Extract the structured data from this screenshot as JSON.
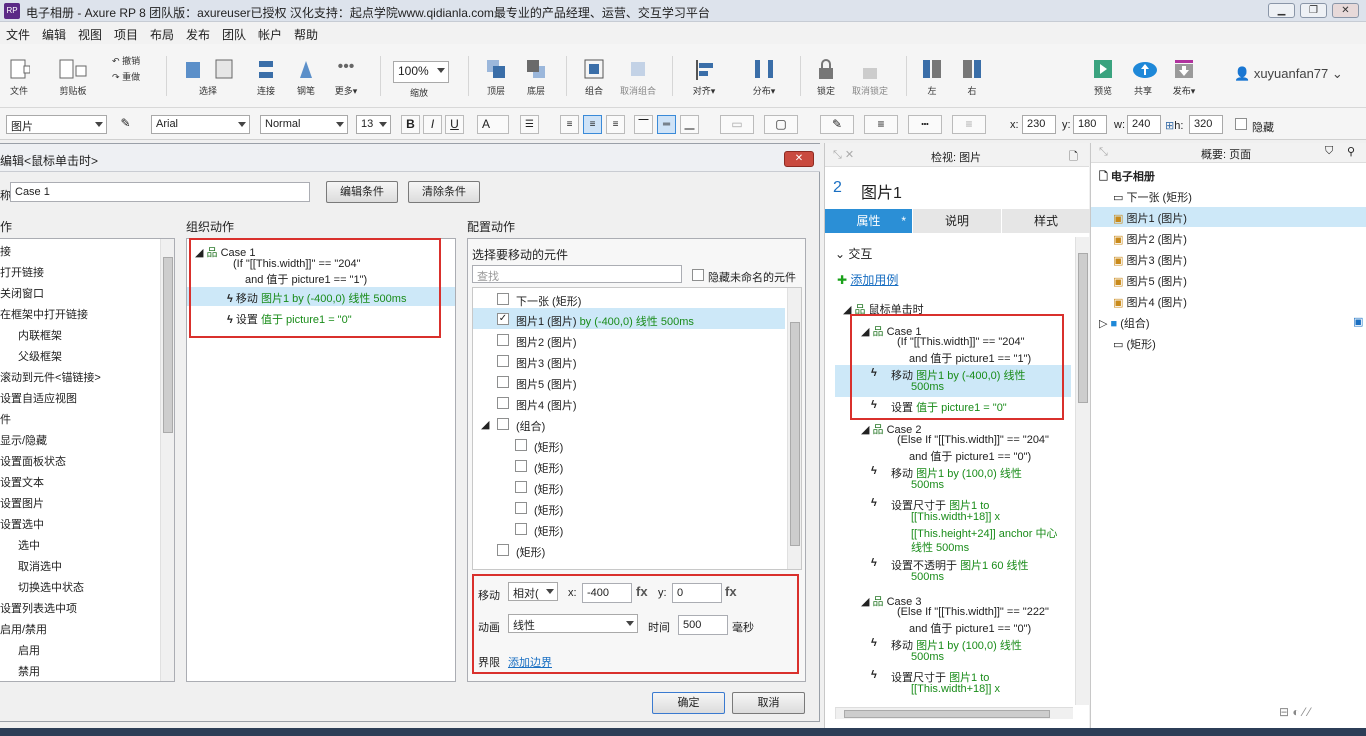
{
  "window": {
    "title": "电子相册 - Axure RP 8 团队版：axureuser已授权 汉化支持：起点学院www.qidianla.com最专业的产品经理、运营、交互学习平台",
    "app_icon": "RP"
  },
  "menu": [
    "文件",
    "编辑",
    "视图",
    "项目",
    "布局",
    "发布",
    "团队",
    "帐户",
    "帮助"
  ],
  "toolbar": {
    "file": "文件",
    "clipboard": "剪贴板",
    "undo": "撤销",
    "redo": "重做",
    "select": "选择",
    "connect": "连接",
    "pen": "钢笔",
    "more": "更多▾",
    "zoom_value": "100%",
    "zoom": "缩放",
    "top": "顶层",
    "bottom": "底层",
    "group": "组合",
    "ungroup": "取消组合",
    "align": "对齐▾",
    "distribute": "分布▾",
    "lock": "锁定",
    "unlock": "取消锁定",
    "left": "左",
    "right": "右",
    "preview": "预览",
    "share": "共享",
    "publish": "发布▾",
    "user": "xuyuanfan77"
  },
  "format": {
    "widget": "图片",
    "font": "Arial",
    "style": "Normal",
    "size": "13",
    "bold": "B",
    "italic": "I",
    "underline": "U",
    "text_color": "A",
    "x_label": "x:",
    "x": "230",
    "y_label": "y:",
    "y": "180",
    "w_label": "w:",
    "w": "240",
    "h_label": "h:",
    "h": "320",
    "hidden": "隐藏"
  },
  "dialog": {
    "title": "编辑<鼠标单击时>",
    "case_label": "称",
    "case_name": "Case 1",
    "edit_condition": "编辑条件",
    "clear_condition": "清除条件",
    "col1_header": "作",
    "col2_header": "组织动作",
    "col3_header": "配置动作",
    "actions": [
      "接",
      "打开链接",
      "关闭窗口",
      "在框架中打开链接",
      "内联框架",
      "父级框架",
      "滚动到元件<锚链接>",
      "设置自适应视图",
      "件",
      "显示/隐藏",
      "设置面板状态",
      "设置文本",
      "设置图片",
      "设置选中",
      "选中",
      "取消选中",
      "切换选中状态",
      "设置列表选中项",
      "启用/禁用",
      "启用",
      "禁用"
    ],
    "org": {
      "case": "Case 1",
      "cond1": "(If \"[[This.width]]\" == \"204\"",
      "cond2": "and 值于 picture1 == \"1\")",
      "a1_verb": "移动",
      "a1_detail": "图片1 by (-400,0) 线性 500ms",
      "a2_verb": "设置",
      "a2_detail": "值于 picture1 = \"0\""
    },
    "config": {
      "header": "选择要移动的元件",
      "search_placeholder": "查找",
      "hide_unnamed": "隐藏未命名的元件",
      "items": [
        {
          "label": "下一张 (矩形)",
          "checked": false
        },
        {
          "label": "图片1 (图片)",
          "checked": true,
          "extra": "by (-400,0) 线性 500ms"
        },
        {
          "label": "图片2 (图片)",
          "checked": false
        },
        {
          "label": "图片3 (图片)",
          "checked": false
        },
        {
          "label": "图片5 (图片)",
          "checked": false
        },
        {
          "label": "图片4 (图片)",
          "checked": false
        }
      ],
      "group": "(组合)",
      "rects": [
        "(矩形)",
        "(矩形)",
        "(矩形)",
        "(矩形)",
        "(矩形)"
      ],
      "last": "(矩形)",
      "move": "移动",
      "move_mode": "相对(",
      "x_label": "x:",
      "x": "-400",
      "fx": "fx",
      "y_label": "y:",
      "y": "0",
      "anim": "动画",
      "anim_value": "线性",
      "time": "时间",
      "time_value": "500",
      "ms": "毫秒",
      "bound": "界限",
      "add_bound": "添加边界"
    },
    "ok": "确定",
    "cancel": "取消"
  },
  "inspector": {
    "title": "检视: 图片",
    "num": "2",
    "name": "图片1",
    "tabs": [
      "属性",
      "说明",
      "样式"
    ],
    "interaction": "交互",
    "add_case": "添加用例",
    "event": "鼠标单击时",
    "cases": [
      {
        "name": "Case 1",
        "cond": [
          "(If \"[[This.width]]\" == \"204\"",
          "and 值于 picture1 == \"1\")"
        ],
        "acts": [
          [
            "移动 ",
            "图片1 by (-400,0) 线性"
          ],
          [
            "",
            "500ms"
          ],
          [
            "设置 ",
            "值于 picture1 = \"0\""
          ]
        ]
      },
      {
        "name": "Case 2",
        "cond": [
          "(Else If \"[[This.width]]\" == \"204\"",
          "and 值于 picture1 == \"0\")"
        ],
        "acts": [
          [
            "移动 ",
            "图片1 by (100,0) 线性"
          ],
          [
            "",
            "500ms"
          ],
          [
            "设置尺寸于 ",
            "图片1 to"
          ],
          [
            "",
            "[[This.width+18]] x"
          ],
          [
            "",
            "[[This.height+24]] anchor 中心"
          ],
          [
            "",
            "线性 500ms"
          ],
          [
            "设置不透明于 ",
            "图片1 60 线性"
          ],
          [
            "",
            "500ms"
          ]
        ]
      },
      {
        "name": "Case 3",
        "cond": [
          "(Else If \"[[This.width]]\" == \"222\"",
          "and 值于 picture1 == \"0\")"
        ],
        "acts": [
          [
            "移动 ",
            "图片1 by (100,0) 线性"
          ],
          [
            "",
            "500ms"
          ],
          [
            "设置尺寸于 ",
            "图片1 to"
          ],
          [
            "",
            "[[This.width+18]] x"
          ]
        ]
      }
    ]
  },
  "outline": {
    "title": "概要: 页面",
    "root": "电子相册",
    "items": [
      "下一张 (矩形)",
      "图片1 (图片)",
      "图片2 (图片)",
      "图片3 (图片)",
      "图片5 (图片)",
      "图片4 (图片)",
      "(组合)",
      "(矩形)"
    ]
  }
}
